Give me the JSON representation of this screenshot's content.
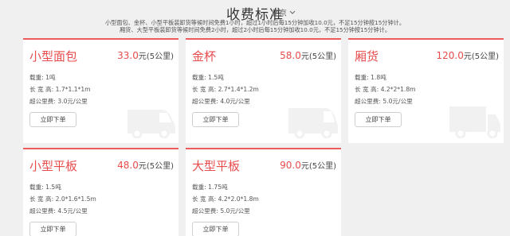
{
  "page": {
    "title": "收费标准",
    "city": "北京",
    "note_line1": "小型面包、金杯、小型平板装卸货等候时间免费1小时，超过1小时后每15分钟加收10.0元，不足15分钟按15分钟计。",
    "note_line2": "厢货、大型平板装卸货等候时间免费2小时，超过2小时后每15分钟加收10.0元，不足15分钟按15分钟计。"
  },
  "cards": [
    {
      "name": "小型面包",
      "price": "33.0",
      "price_unit": "元(5公里)",
      "load": "载重: 1吨",
      "size": "长 宽 高: 1.7*1.1*1m",
      "extra": "超公里费: 3.0元/公里",
      "button": "立即下单"
    },
    {
      "name": "金杯",
      "price": "58.0",
      "price_unit": "元(5公里)",
      "load": "载重: 1.5吨",
      "size": "长 宽 高: 2.7*1.4*1.2m",
      "extra": "超公里费: 4.0元/公里",
      "button": "立即下单"
    },
    {
      "name": "厢货",
      "price": "120.0",
      "price_unit": "元(5公里)",
      "load": "载重: 1.8吨",
      "size": "长 宽 高: 4.2*2*1.8m",
      "extra": "超公里费: 5.0元/公里",
      "button": "立即下单"
    },
    {
      "name": "小型平板",
      "price": "48.0",
      "price_unit": "元(5公里)",
      "load": "载重: 1.5吨",
      "size": "长 宽 高: 2.0*1.6*1.5m",
      "extra": "超公里费: 4.5元/公里",
      "button": "立即下单"
    },
    {
      "name": "大型平板",
      "price": "90.0",
      "price_unit": "元(5公里)",
      "load": "载重: 1.75吨",
      "size": "长 宽 高: 4.2*2.0*1.8m",
      "extra": "超公里费: 5.0元/公里",
      "button": "立即下单"
    }
  ],
  "colors": {
    "accent": "#e84c4c",
    "background": "#f0f0f0"
  },
  "icons": {
    "city_dropdown": "chevron-down-icon",
    "vehicle": "truck-icon"
  }
}
